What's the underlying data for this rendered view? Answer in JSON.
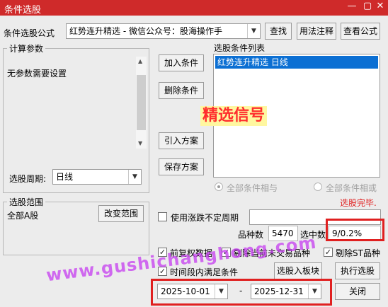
{
  "window": {
    "title": "条件选股",
    "min_icon": "minimize-icon",
    "max_icon": "maximize-icon",
    "close_icon": "close-icon"
  },
  "formula": {
    "label": "条件选股公式",
    "value": "红势连升精选  -  微信公众号：股海操作手",
    "find_btn": "查找",
    "usage_btn": "用法注释",
    "view_btn": "查看公式"
  },
  "calc": {
    "legend": "计算参数",
    "text": "无参数需要设置"
  },
  "period": {
    "label": "选股周期:",
    "value": "日线"
  },
  "actions": {
    "add": "加入条件",
    "delete": "删除条件",
    "import": "引入方案",
    "save": "保存方案"
  },
  "conditions": {
    "label": "选股条件列表",
    "items": [
      "红势连升精选  日线"
    ],
    "overlay": "精选信号",
    "radio_and": "全部条件相与",
    "radio_or": "全部条件相或"
  },
  "status": "选股完毕.",
  "range": {
    "legend": "选股范围",
    "value": "全部A股",
    "change_btn": "改变范围"
  },
  "uncertain_period": {
    "label": "使用涨跌不定周期",
    "value": ""
  },
  "stats": {
    "count_label": "品种数",
    "count_value": "5470",
    "selected_label": "选中数",
    "selected_value": "9/0.2%"
  },
  "options": {
    "fq": "前复权数据",
    "exclude_untraded": "剔除当前未交易品种",
    "exclude_st": "剔除ST品种",
    "time_range": "时间段内满足条件"
  },
  "dates": {
    "start": "2025-10-01",
    "sep": "-",
    "end": "2025-12-31"
  },
  "buttons": {
    "to_board": "选股入板块",
    "execute": "执行选股",
    "close": "关闭"
  },
  "watermark": "www.gushichanghong.com",
  "colors": {
    "title_bar": "#cf2a2a",
    "selection": "#0b6fd3",
    "red": "#e02020",
    "watermark": "#c63df0"
  }
}
